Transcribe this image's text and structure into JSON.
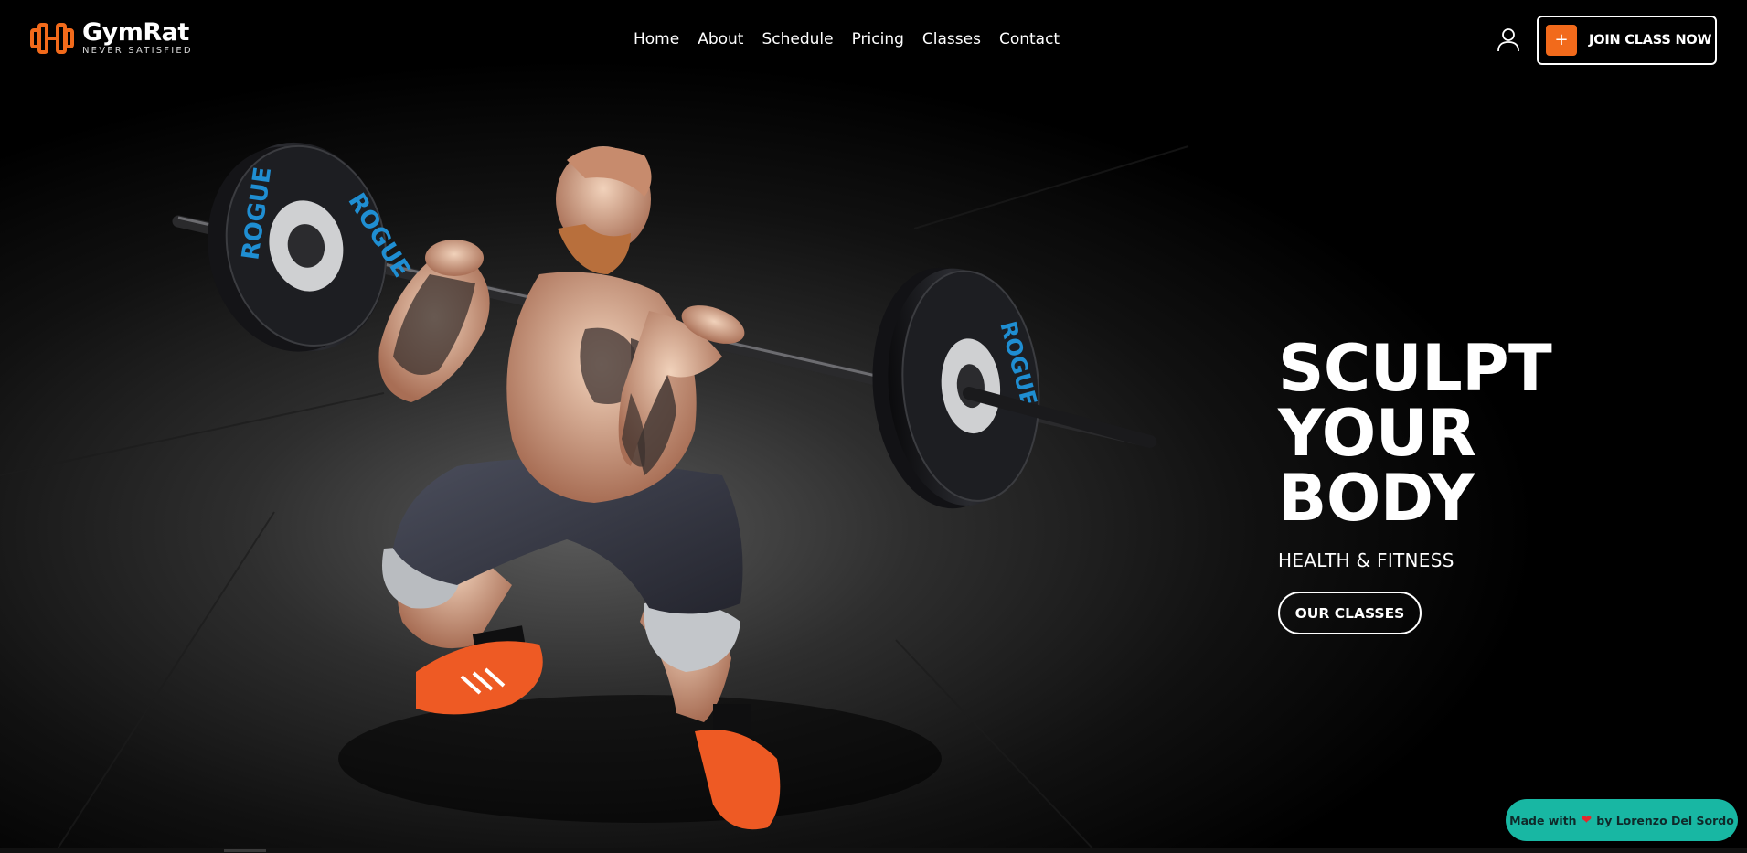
{
  "brand": {
    "name": "GymRat",
    "tagline": "NEVER SATISFIED",
    "accent_color": "#f26a1b",
    "logo_icon": "dumbbell-icon"
  },
  "nav": {
    "items": [
      {
        "label": "Home"
      },
      {
        "label": "About"
      },
      {
        "label": "Schedule"
      },
      {
        "label": "Pricing"
      },
      {
        "label": "Classes"
      },
      {
        "label": "Contact"
      }
    ]
  },
  "header_actions": {
    "account_icon": "user-icon",
    "join_icon": "plus-icon",
    "join_label": "JOIN CLASS NOW"
  },
  "hero": {
    "title_lines": [
      "SCULPT",
      "YOUR",
      "BODY"
    ],
    "subtitle": "HEALTH & FITNESS",
    "cta_label": "OUR CLASSES"
  },
  "credit": {
    "prefix": "Made with",
    "icon": "heart-icon",
    "suffix": "by Lorenzo Del Sordo",
    "color": "#18b7a3"
  }
}
